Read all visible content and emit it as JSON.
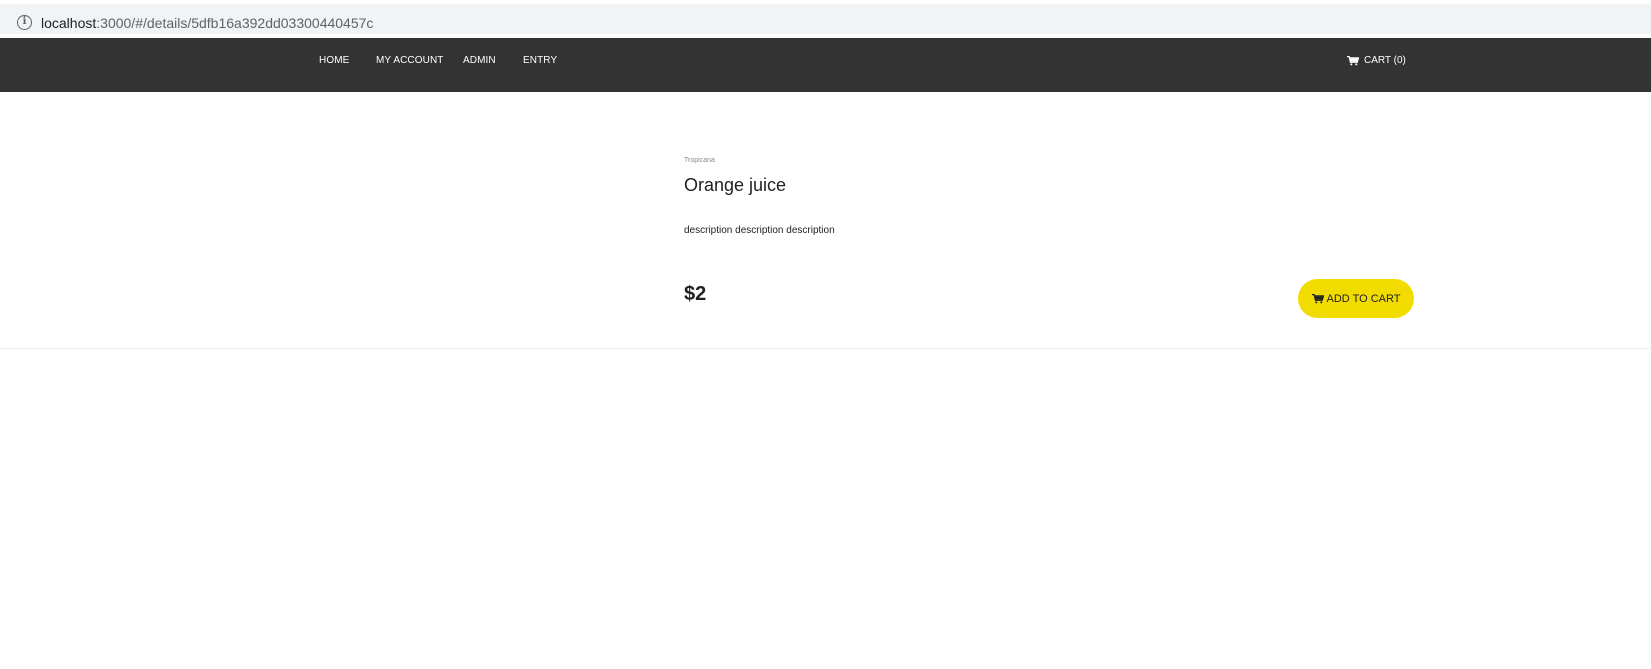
{
  "browser": {
    "url_host": "localhost",
    "url_rest": ":3000/#/details/5dfb16a392dd03300440457c",
    "info_icon": "info-icon"
  },
  "navbar": {
    "items": [
      {
        "label": "HOME"
      },
      {
        "label": "MY ACCOUNT"
      },
      {
        "label": "ADMIN"
      },
      {
        "label": "ENTRY"
      }
    ],
    "cart_label": "CART (0)",
    "cart_icon": "cart-icon",
    "background": "#333333"
  },
  "product": {
    "brand": "Tropicana",
    "title": "Orange juice",
    "description": "description description description",
    "price": "$2",
    "add_to_cart_label": "ADD TO CART",
    "add_to_cart_color": "#f2dc00"
  }
}
